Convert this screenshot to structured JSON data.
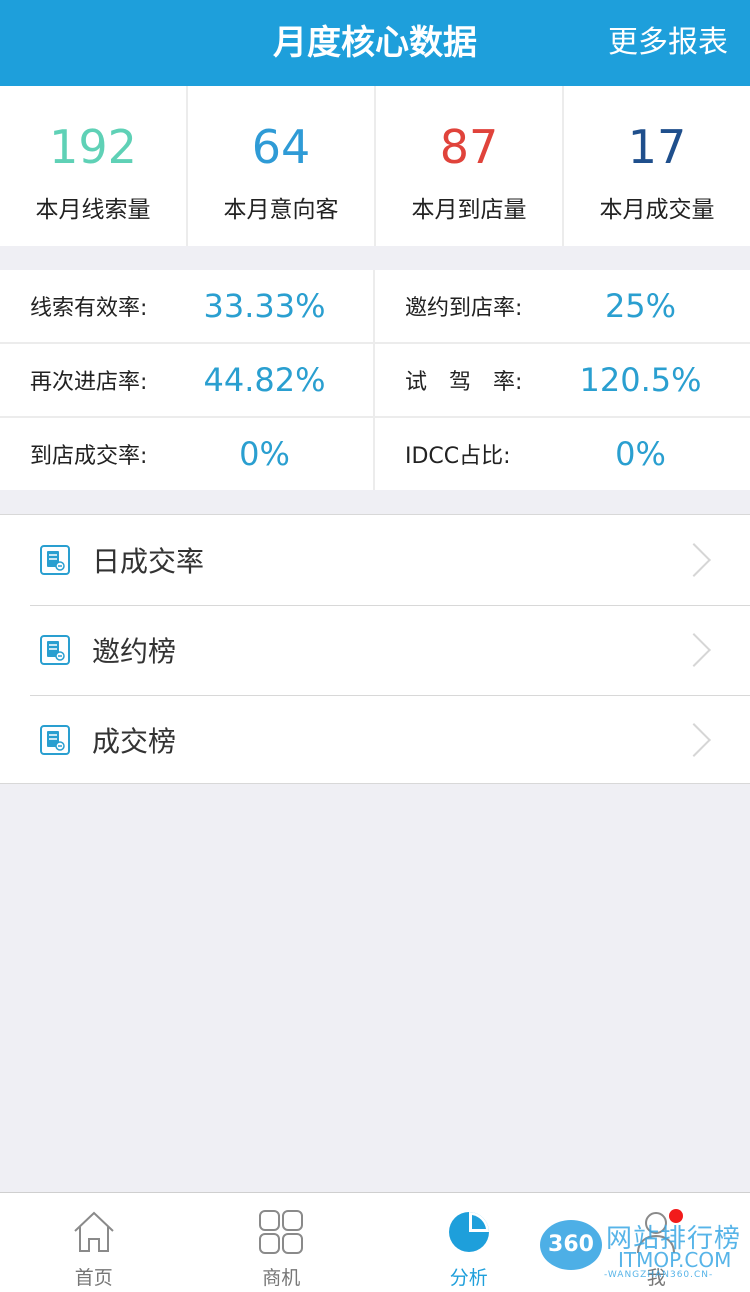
{
  "header": {
    "title": "月度核心数据",
    "more": "更多报表"
  },
  "stats": [
    {
      "value": "192",
      "label": "本月线索量",
      "color": "#5fd1b6"
    },
    {
      "value": "64",
      "label": "本月意向客",
      "color": "#2f9bd6"
    },
    {
      "value": "87",
      "label": "本月到店量",
      "color": "#e0433b"
    },
    {
      "value": "17",
      "label": "本月成交量",
      "color": "#1f4f8c"
    }
  ],
  "rates": [
    [
      {
        "label": "线索有效率:",
        "value": "33.33%"
      },
      {
        "label": "邀约到店率:",
        "value": "25%"
      }
    ],
    [
      {
        "label": "再次进店率:",
        "value": "44.82%"
      },
      {
        "label": "试　驾　率:",
        "value": "120.5%"
      }
    ],
    [
      {
        "label": "到店成交率:",
        "value": "0%"
      },
      {
        "label": "IDCC占比:",
        "value": "0%"
      }
    ]
  ],
  "menu": [
    {
      "label": "日成交率",
      "icon": "report-icon"
    },
    {
      "label": "邀约榜",
      "icon": "report-icon"
    },
    {
      "label": "成交榜",
      "icon": "report-icon"
    }
  ],
  "tabs": [
    {
      "label": "首页",
      "icon": "home-icon"
    },
    {
      "label": "商机",
      "icon": "grid-icon"
    },
    {
      "label": "分析",
      "icon": "pie-chart-icon",
      "active": true
    },
    {
      "label": "我",
      "icon": "user-icon"
    }
  ],
  "watermark": {
    "badge": "360",
    "title": "网站排行榜",
    "url": "ITMOP.COM",
    "sub": "-WANGZHAN360.CN-"
  },
  "colors": {
    "primary": "#1e9fdb",
    "rate_value": "#2a9fd0",
    "notification_dot": "#f21b1b"
  }
}
